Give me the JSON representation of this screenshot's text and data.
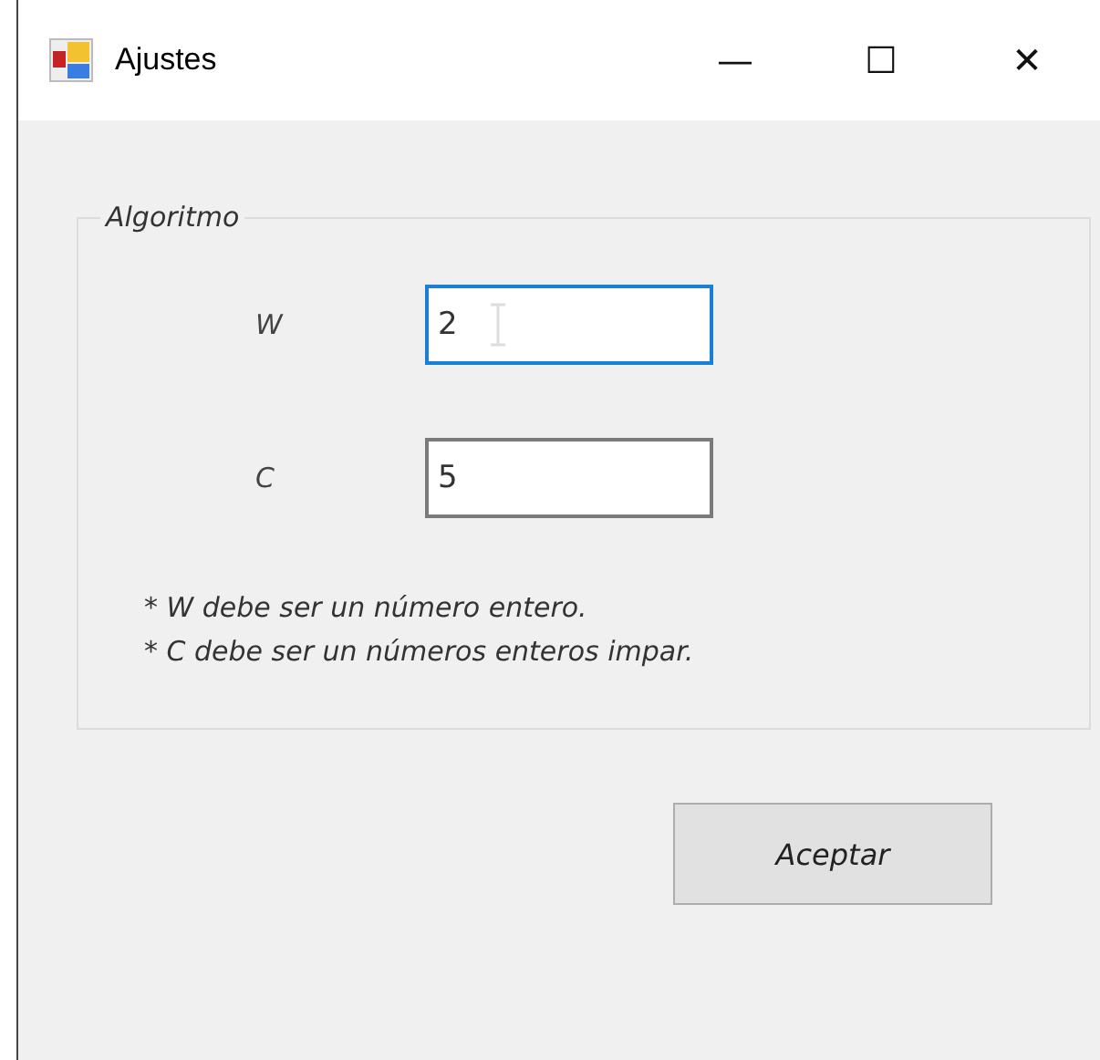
{
  "window": {
    "title": "Ajustes",
    "controls": [
      "—",
      "☐",
      "✕"
    ]
  },
  "group": {
    "title": "Algoritmo",
    "fields": [
      {
        "label": "W",
        "value": "2",
        "focused": true
      },
      {
        "label": "C",
        "value": "5",
        "focused": false
      }
    ],
    "notes": [
      "* W debe ser un número entero.",
      "* C debe ser un números enteros impar."
    ]
  },
  "buttons": [
    {
      "label": "Aceptar"
    }
  ]
}
